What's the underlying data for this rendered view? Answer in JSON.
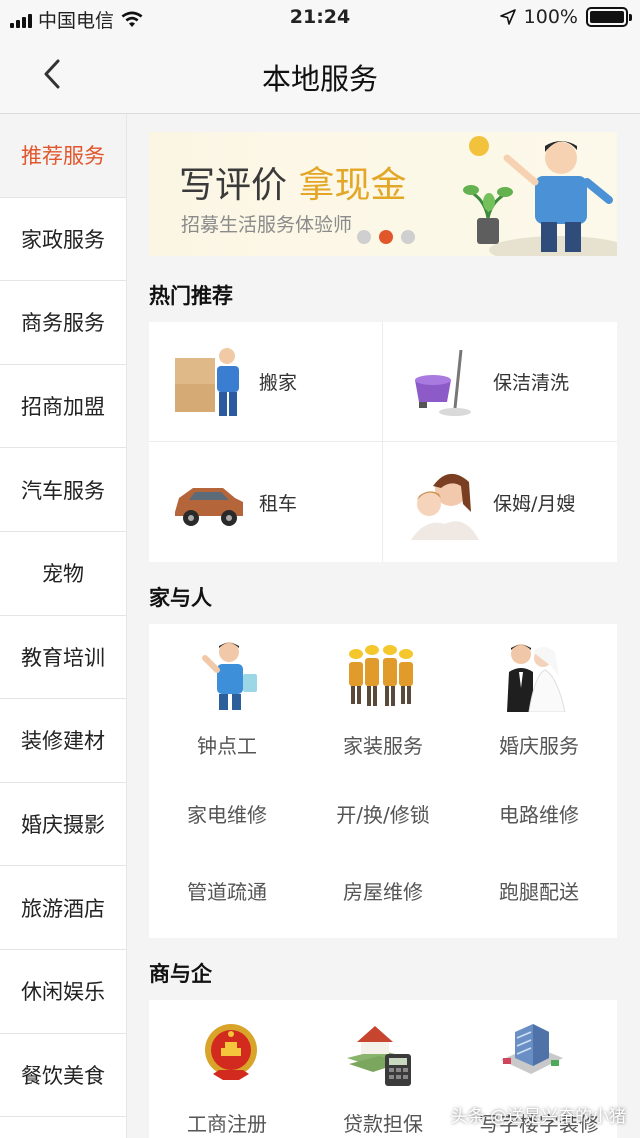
{
  "status_bar": {
    "carrier": "中国电信",
    "time": "21:24",
    "battery": "100%"
  },
  "nav": {
    "title": "本地服务"
  },
  "sidebar": {
    "items": [
      "推荐服务",
      "家政服务",
      "商务服务",
      "招商加盟",
      "汽车服务",
      "宠物",
      "教育培训",
      "装修建材",
      "婚庆摄影",
      "旅游酒店",
      "休闲娱乐",
      "餐饮美食"
    ]
  },
  "banner": {
    "title_a": "写评价",
    "title_b": "拿现金",
    "subtitle": "招募生活服务体验师",
    "slide_count": 3,
    "active_slide": 2
  },
  "hot": {
    "title": "热门推荐",
    "items": [
      "搬家",
      "保洁清洗",
      "租车",
      "保姆/月嫂"
    ]
  },
  "home": {
    "title": "家与人",
    "row1": [
      "钟点工",
      "家装服务",
      "婚庆服务"
    ],
    "row2": [
      "家电维修",
      "开/换/修锁",
      "电路维修"
    ],
    "row3": [
      "管道疏通",
      "房屋维修",
      "跑腿配送"
    ]
  },
  "biz": {
    "title": "商与企",
    "items": [
      "工商注册",
      "贷款担保",
      "写字楼字装修"
    ]
  },
  "watermark": "头条 @送是兴奋的小猪",
  "colors": {
    "accent": "#e2562c",
    "banner_highlight": "#e3a626"
  }
}
